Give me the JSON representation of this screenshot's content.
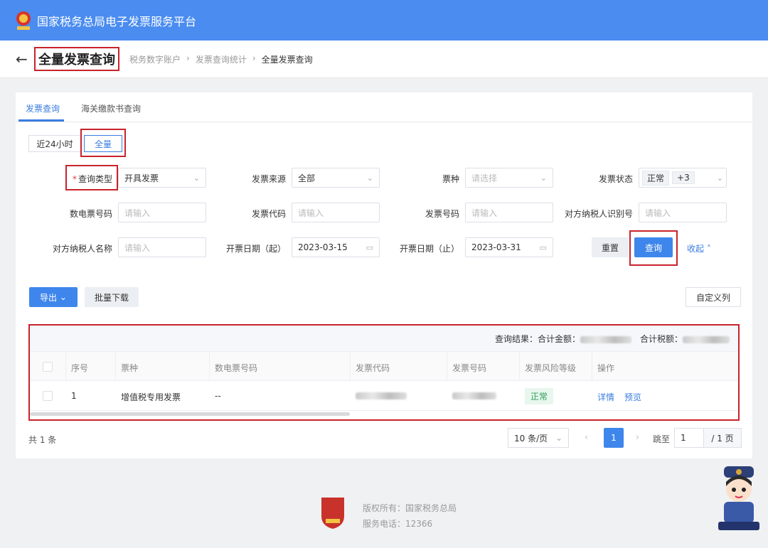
{
  "header": {
    "title": "国家税务总局电子发票服务平台"
  },
  "page": {
    "title": "全量发票查询",
    "breadcrumbs": [
      "税务数字账户",
      "发票查询统计",
      "全量发票查询"
    ]
  },
  "tabs": [
    {
      "label": "发票查询"
    },
    {
      "label": "海关缴款书查询"
    }
  ],
  "time_range": {
    "opt1": "近24小时",
    "opt2": "全量"
  },
  "filters": {
    "query_type": {
      "label": "查询类型",
      "value": "开具发票"
    },
    "invoice_source": {
      "label": "发票来源",
      "value": "全部"
    },
    "invoice_kind": {
      "label": "票种",
      "placeholder": "请选择"
    },
    "invoice_status": {
      "label": "发票状态",
      "tag": "正常",
      "more": "+3"
    },
    "e_invoice_no": {
      "label": "数电票号码",
      "placeholder": "请输入"
    },
    "invoice_code": {
      "label": "发票代码",
      "placeholder": "请输入"
    },
    "invoice_number": {
      "label": "发票号码",
      "placeholder": "请输入"
    },
    "counterparty_taxid": {
      "label": "对方纳税人识别号",
      "placeholder": "请输入"
    },
    "counterparty_name": {
      "label": "对方纳税人名称",
      "placeholder": "请输入"
    },
    "date_start": {
      "label": "开票日期（起）",
      "value": "2023-03-15"
    },
    "date_end": {
      "label": "开票日期（止）",
      "value": "2023-03-31"
    }
  },
  "actions": {
    "reset": "重置",
    "search": "查询",
    "collapse": "收起",
    "export": "导出",
    "batch_download": "批量下载",
    "custom_columns": "自定义列"
  },
  "summary": {
    "total_amount_label": "查询结果：合计金额：",
    "total_tax_label": "合计税额："
  },
  "table": {
    "columns": [
      "序号",
      "票种",
      "数电票号码",
      "发票代码",
      "发票号码",
      "发票风险等级",
      "操作"
    ],
    "rows": [
      {
        "index": "1",
        "kind": "增值税专用发票",
        "e_no": "--",
        "risk": "正常",
        "op_detail": "详情",
        "op_preview": "预览"
      }
    ]
  },
  "pagination": {
    "total": "共 1 条",
    "page_size": "10 条/页",
    "current": "1",
    "goto_label": "跳至",
    "goto_value": "1",
    "total_pages": "/ 1 页"
  },
  "footer": {
    "copyright": "版权所有：国家税务总局",
    "hotline": "服务电话：12366"
  },
  "colors": {
    "primary": "#3e86ec",
    "header": "#4a8cf0",
    "highlight": "#c8232c",
    "success": "#2e9e5b"
  }
}
